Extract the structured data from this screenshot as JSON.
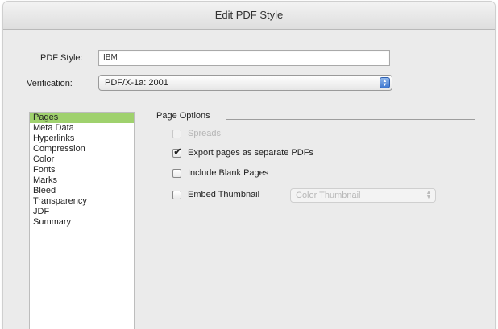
{
  "window": {
    "title": "Edit PDF Style"
  },
  "form": {
    "pdf_style_label": "PDF Style:",
    "pdf_style_value": "IBM",
    "verification_label": "Verification:",
    "verification_value": "PDF/X-1a: 2001"
  },
  "sidebar": {
    "items": [
      {
        "label": "Pages",
        "selected": true
      },
      {
        "label": "Meta Data",
        "selected": false
      },
      {
        "label": "Hyperlinks",
        "selected": false
      },
      {
        "label": "Compression",
        "selected": false
      },
      {
        "label": "Color",
        "selected": false
      },
      {
        "label": "Fonts",
        "selected": false
      },
      {
        "label": "Marks",
        "selected": false
      },
      {
        "label": "Bleed",
        "selected": false
      },
      {
        "label": "Transparency",
        "selected": false
      },
      {
        "label": "JDF",
        "selected": false
      },
      {
        "label": "Summary",
        "selected": false
      }
    ]
  },
  "page_options": {
    "title": "Page Options",
    "spreads": {
      "label": "Spreads",
      "checked": false,
      "enabled": false
    },
    "export_separate": {
      "label": "Export pages as separate PDFs",
      "checked": true,
      "enabled": true
    },
    "include_blank": {
      "label": "Include Blank Pages",
      "checked": false,
      "enabled": true
    },
    "embed_thumbnail": {
      "label": "Embed Thumbnail",
      "checked": false,
      "enabled": true
    },
    "thumbnail_option": "Color Thumbnail"
  },
  "colors": {
    "selection": "#9fd16d",
    "stepper": "#3d77d1"
  },
  "icons": {
    "check": "checkmark-icon",
    "stepper": "up-down-arrows-icon"
  }
}
